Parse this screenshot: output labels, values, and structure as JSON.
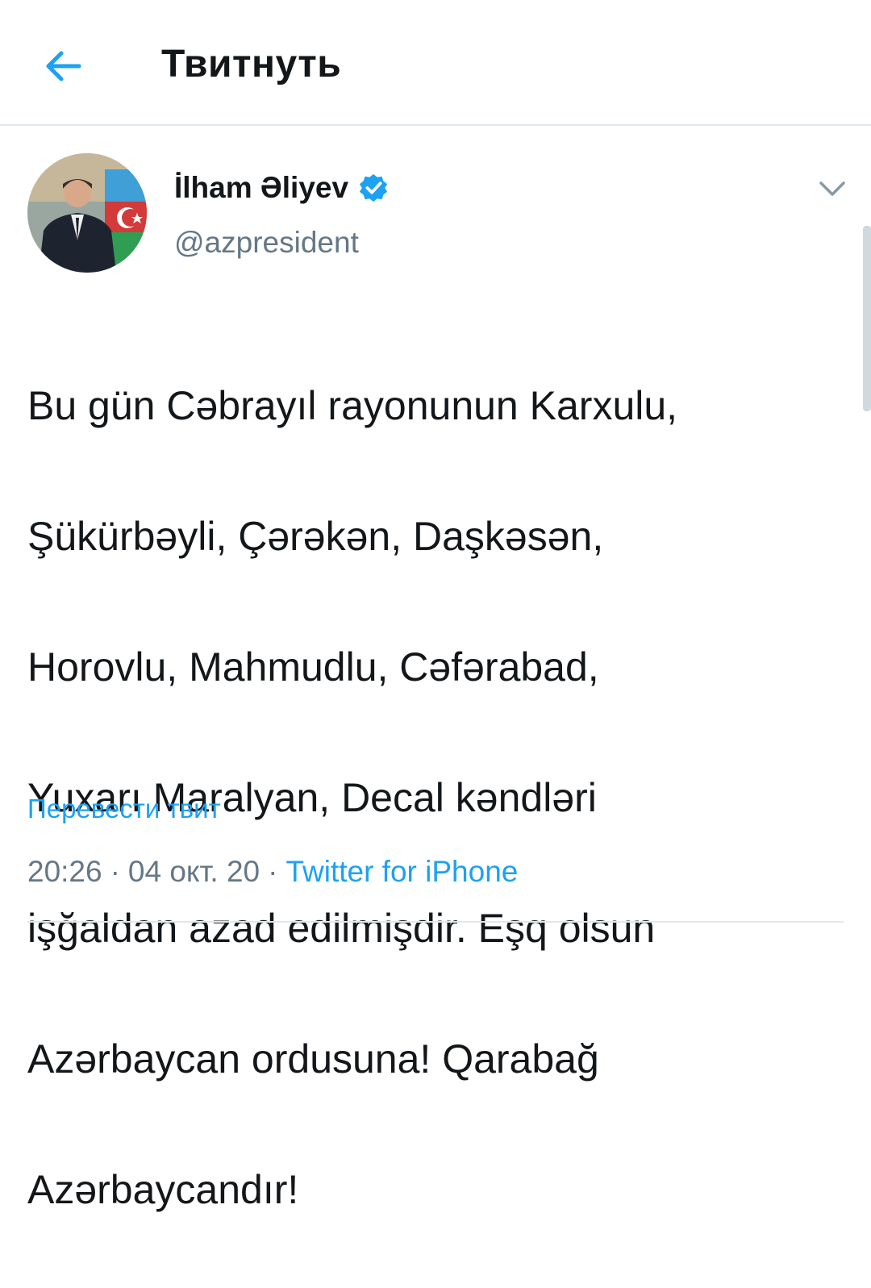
{
  "header": {
    "title": "Твитнуть",
    "back_icon": "arrow-left-icon"
  },
  "tweet": {
    "author": {
      "name": "İlham Əliyev",
      "handle": "@azpresident",
      "verified": true,
      "avatar": "profile-photo"
    },
    "text_lines": [
      "Bu gün Cəbrayıl rayonunun Karxulu,",
      "Şükürbəyli, Çərəkən, Daşkəsən,",
      "Horovlu, Mahmudlu, Cəfərabad,",
      "Yuxarı Maralyan, Decal kəndləri",
      "işğaldan azad edilmişdir. Eşq olsun",
      "Azərbaycan ordusuna! Qarabağ",
      "Azərbaycandır!"
    ],
    "translate_label": "Перевести твит",
    "time": "20:26",
    "separator": "·",
    "date": "04 окт. 20",
    "source": "Twitter for iPhone"
  },
  "colors": {
    "accent": "#1da1f2",
    "text": "#14171a",
    "secondary": "#657786",
    "divider": "#e1e8ed"
  }
}
